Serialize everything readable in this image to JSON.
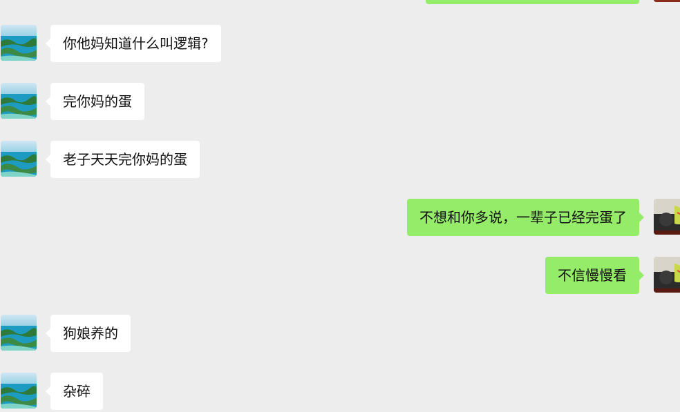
{
  "messages": [
    {
      "direction": "in",
      "text": "你他妈知道什么叫逻辑?"
    },
    {
      "direction": "in",
      "text": "完你妈的蛋"
    },
    {
      "direction": "in",
      "text": "老子天天完你妈的蛋"
    },
    {
      "direction": "out",
      "text": "不想和你多说，一辈子已经完蛋了"
    },
    {
      "direction": "out",
      "text": "不信慢慢看"
    },
    {
      "direction": "in",
      "text": "狗娘养的"
    },
    {
      "direction": "in",
      "text": "杂碎"
    }
  ],
  "colors": {
    "background": "#ededed",
    "incoming_bubble": "#ffffff",
    "outgoing_bubble": "#95ec69"
  },
  "icons": {
    "contact_avatar": "island-landscape-avatar",
    "self_avatar": "dark-photo-avatar"
  }
}
